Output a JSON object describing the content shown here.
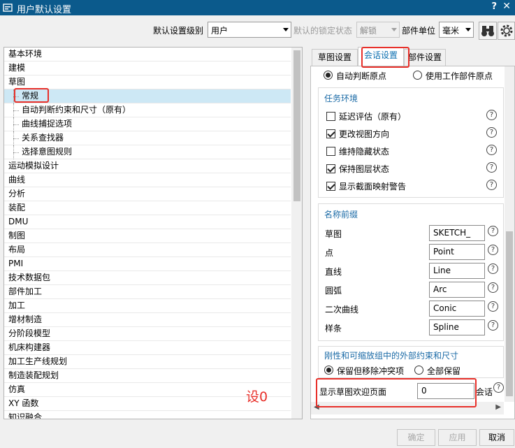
{
  "window": {
    "title": "用户默认设置",
    "help": "?",
    "close": "✕"
  },
  "toolbar": {
    "level_label": "默认设置级别",
    "level_value": "用户",
    "lock_label": "默认的锁定状态",
    "lock_value": "解锁",
    "unit_label": "部件单位",
    "unit_value": "毫米"
  },
  "tree": {
    "items": [
      {
        "label": "基本环境",
        "level": 0
      },
      {
        "label": "建模",
        "level": 0
      },
      {
        "label": "草图",
        "level": 0
      },
      {
        "label": "常规",
        "level": 1,
        "selected": true
      },
      {
        "label": "自动判断约束和尺寸（原有）",
        "level": 1
      },
      {
        "label": "曲线捕捉选项",
        "level": 1
      },
      {
        "label": "关系查找器",
        "level": 1
      },
      {
        "label": "选择意图规则",
        "level": 1
      },
      {
        "label": "运动模拟设计",
        "level": 0
      },
      {
        "label": "曲线",
        "level": 0
      },
      {
        "label": "分析",
        "level": 0
      },
      {
        "label": "装配",
        "level": 0
      },
      {
        "label": "DMU",
        "level": 0
      },
      {
        "label": "制图",
        "level": 0
      },
      {
        "label": "布局",
        "level": 0
      },
      {
        "label": "PMI",
        "level": 0
      },
      {
        "label": "技术数据包",
        "level": 0
      },
      {
        "label": "部件加工",
        "level": 0
      },
      {
        "label": "加工",
        "level": 0
      },
      {
        "label": "增材制造",
        "level": 0
      },
      {
        "label": "分阶段模型",
        "level": 0
      },
      {
        "label": "机床构建器",
        "level": 0
      },
      {
        "label": "加工生产线规划",
        "level": 0
      },
      {
        "label": "制造装配规划",
        "level": 0
      },
      {
        "label": "仿真",
        "level": 0
      },
      {
        "label": "XY 函数",
        "level": 0
      },
      {
        "label": "知识融合",
        "level": 0
      }
    ]
  },
  "tabs": [
    {
      "label": "草图设置",
      "active": false
    },
    {
      "label": "会话设置",
      "active": true
    },
    {
      "label": "部件设置",
      "active": false
    }
  ],
  "settings": {
    "origin_options": [
      {
        "label": "自动判断原点",
        "checked": true
      },
      {
        "label": "使用工作部件原点",
        "checked": false
      }
    ],
    "task_env": {
      "title": "任务环境",
      "items": [
        {
          "label": "延迟评估（原有）",
          "checked": false
        },
        {
          "label": "更改视图方向",
          "checked": true
        },
        {
          "label": "维持隐藏状态",
          "checked": false
        },
        {
          "label": "保持图层状态",
          "checked": true
        },
        {
          "label": "显示截面映射警告",
          "checked": true
        }
      ]
    },
    "name_prefix": {
      "title": "名称前缀",
      "rows": [
        {
          "label": "草图",
          "value": "SKETCH_"
        },
        {
          "label": "点",
          "value": "Point"
        },
        {
          "label": "直线",
          "value": "Line"
        },
        {
          "label": "圆弧",
          "value": "Arc"
        },
        {
          "label": "二次曲线",
          "value": "Conic"
        },
        {
          "label": "样条",
          "value": "Spline"
        }
      ]
    },
    "rigid": {
      "title": "刚性和可缩放组中的外部约束和尺寸",
      "options": [
        {
          "label": "保留但移除冲突项",
          "checked": true
        },
        {
          "label": "全部保留",
          "checked": false
        }
      ]
    },
    "welcome": {
      "label": "显示草图欢迎页面",
      "value": "0",
      "suffix": "会话"
    }
  },
  "annotation": {
    "text": "设0",
    "color": "#e8302a"
  },
  "buttons": {
    "ok": "确定",
    "apply": "应用",
    "cancel": "取消"
  }
}
